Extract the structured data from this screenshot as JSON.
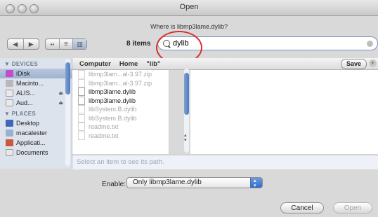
{
  "window": {
    "title": "Open",
    "prompt": "Where is libmp3lame.dylib?"
  },
  "toolbar": {
    "back_icon": "◀",
    "forward_icon": "▶",
    "item_count": "8 items"
  },
  "search": {
    "value": "dylib"
  },
  "sidebar": {
    "devices_header": "▼ DEVICES",
    "places_header": "▼ PLACES",
    "devices": [
      {
        "label": "iDisk",
        "icon": "idisk-icon",
        "color": "#c44ccf"
      },
      {
        "label": "Macinto...",
        "icon": "hard-drive-icon",
        "color": "#b8b8b8"
      },
      {
        "label": "ALIS...",
        "icon": "drive-icon",
        "color": "#eaeaea",
        "eject": "⏏"
      },
      {
        "label": "Aud...",
        "icon": "drive-icon",
        "color": "#eaeaea",
        "eject": "⏏"
      }
    ],
    "places": [
      {
        "label": "Desktop",
        "icon": "desktop-icon",
        "color": "#3f66b8"
      },
      {
        "label": "macalester",
        "icon": "home-icon",
        "color": "#9ab0d0"
      },
      {
        "label": "Applicati...",
        "icon": "applications-icon",
        "color": "#c65a3a"
      },
      {
        "label": "Documents",
        "icon": "documents-icon",
        "color": "#e8e8e8"
      }
    ]
  },
  "pathbar": {
    "crumbs": [
      "Computer",
      "Home",
      "\"lib\""
    ],
    "save_label": "Save",
    "add_label": "+"
  },
  "files": [
    {
      "name": "libmp3lam...al-3.97.zip",
      "enabled": false
    },
    {
      "name": "libmp3lam...al-3.97.zip",
      "enabled": false
    },
    {
      "name": "libmp3lame.dylib",
      "enabled": true
    },
    {
      "name": "libmp3lame.dylib",
      "enabled": true
    },
    {
      "name": "libSystem.B.dylib",
      "enabled": false
    },
    {
      "name": "libSystem.B.dylib",
      "enabled": false
    },
    {
      "name": "readme.txt",
      "enabled": false
    },
    {
      "name": "readme.txt",
      "enabled": false
    }
  ],
  "status": {
    "text": "Select an item to see its path."
  },
  "enable": {
    "label": "Enable:",
    "selected": "Only libmp3lame.dylib"
  },
  "buttons": {
    "cancel": "Cancel",
    "open": "Open"
  },
  "colors": {
    "annotation": "#d8312c",
    "accent": "#4f79bf"
  }
}
